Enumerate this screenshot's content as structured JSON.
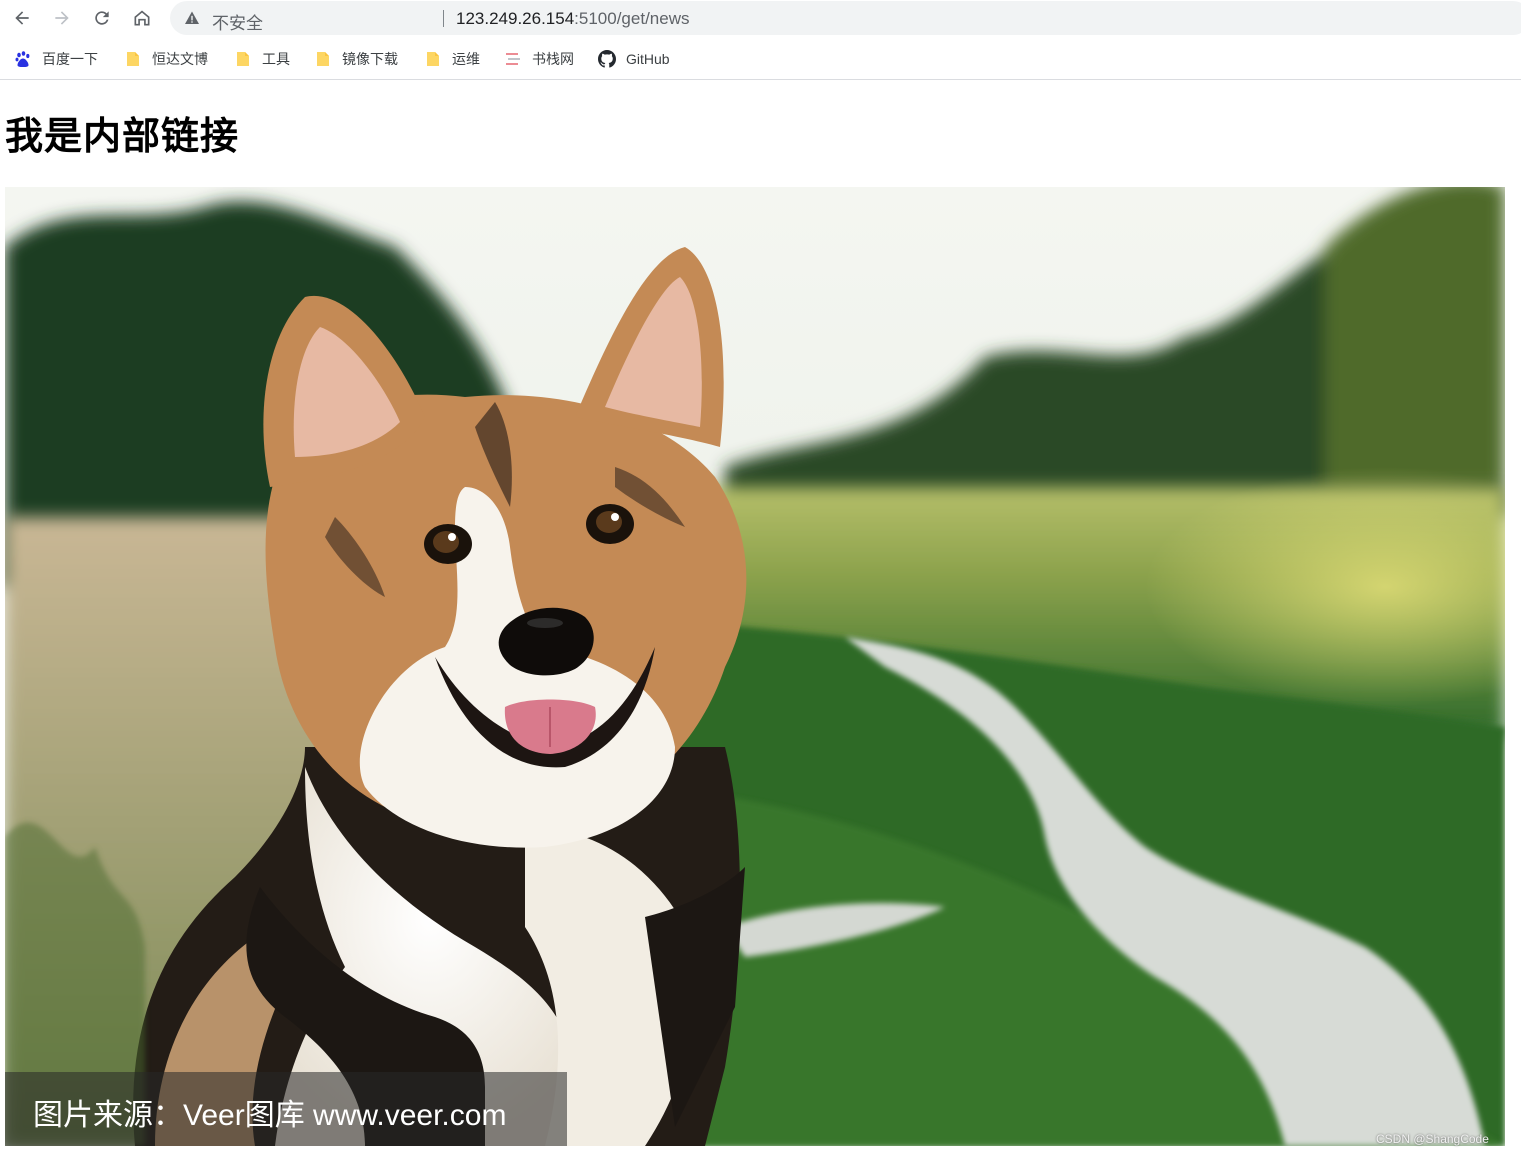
{
  "browser": {
    "security_label": "不安全",
    "url_host": "123.249.26.154",
    "url_path": ":5100/get/news",
    "icons": {
      "back": "back-arrow-icon",
      "forward": "forward-arrow-icon",
      "reload": "reload-icon",
      "home": "home-icon",
      "warning": "warning-triangle-icon"
    }
  },
  "bookmarks": [
    {
      "label": "百度一下",
      "icon": "baidu-paw-icon"
    },
    {
      "label": "恒达文博",
      "icon": "folder-icon"
    },
    {
      "label": "工具",
      "icon": "folder-icon"
    },
    {
      "label": "镜像下载",
      "icon": "folder-icon"
    },
    {
      "label": "运维",
      "icon": "folder-icon"
    },
    {
      "label": "书栈网",
      "icon": "bookstack-icon"
    },
    {
      "label": "GitHub",
      "icon": "github-icon"
    }
  ],
  "page": {
    "heading": "我是内部链接",
    "image": {
      "description_icon": "corgi-photo",
      "caption": "图片来源：Veer图库 www.veer.com",
      "watermark": "CSDN @ShangCode"
    }
  },
  "colors": {
    "folder": "#fdd663",
    "baidu": "#2932e1"
  }
}
